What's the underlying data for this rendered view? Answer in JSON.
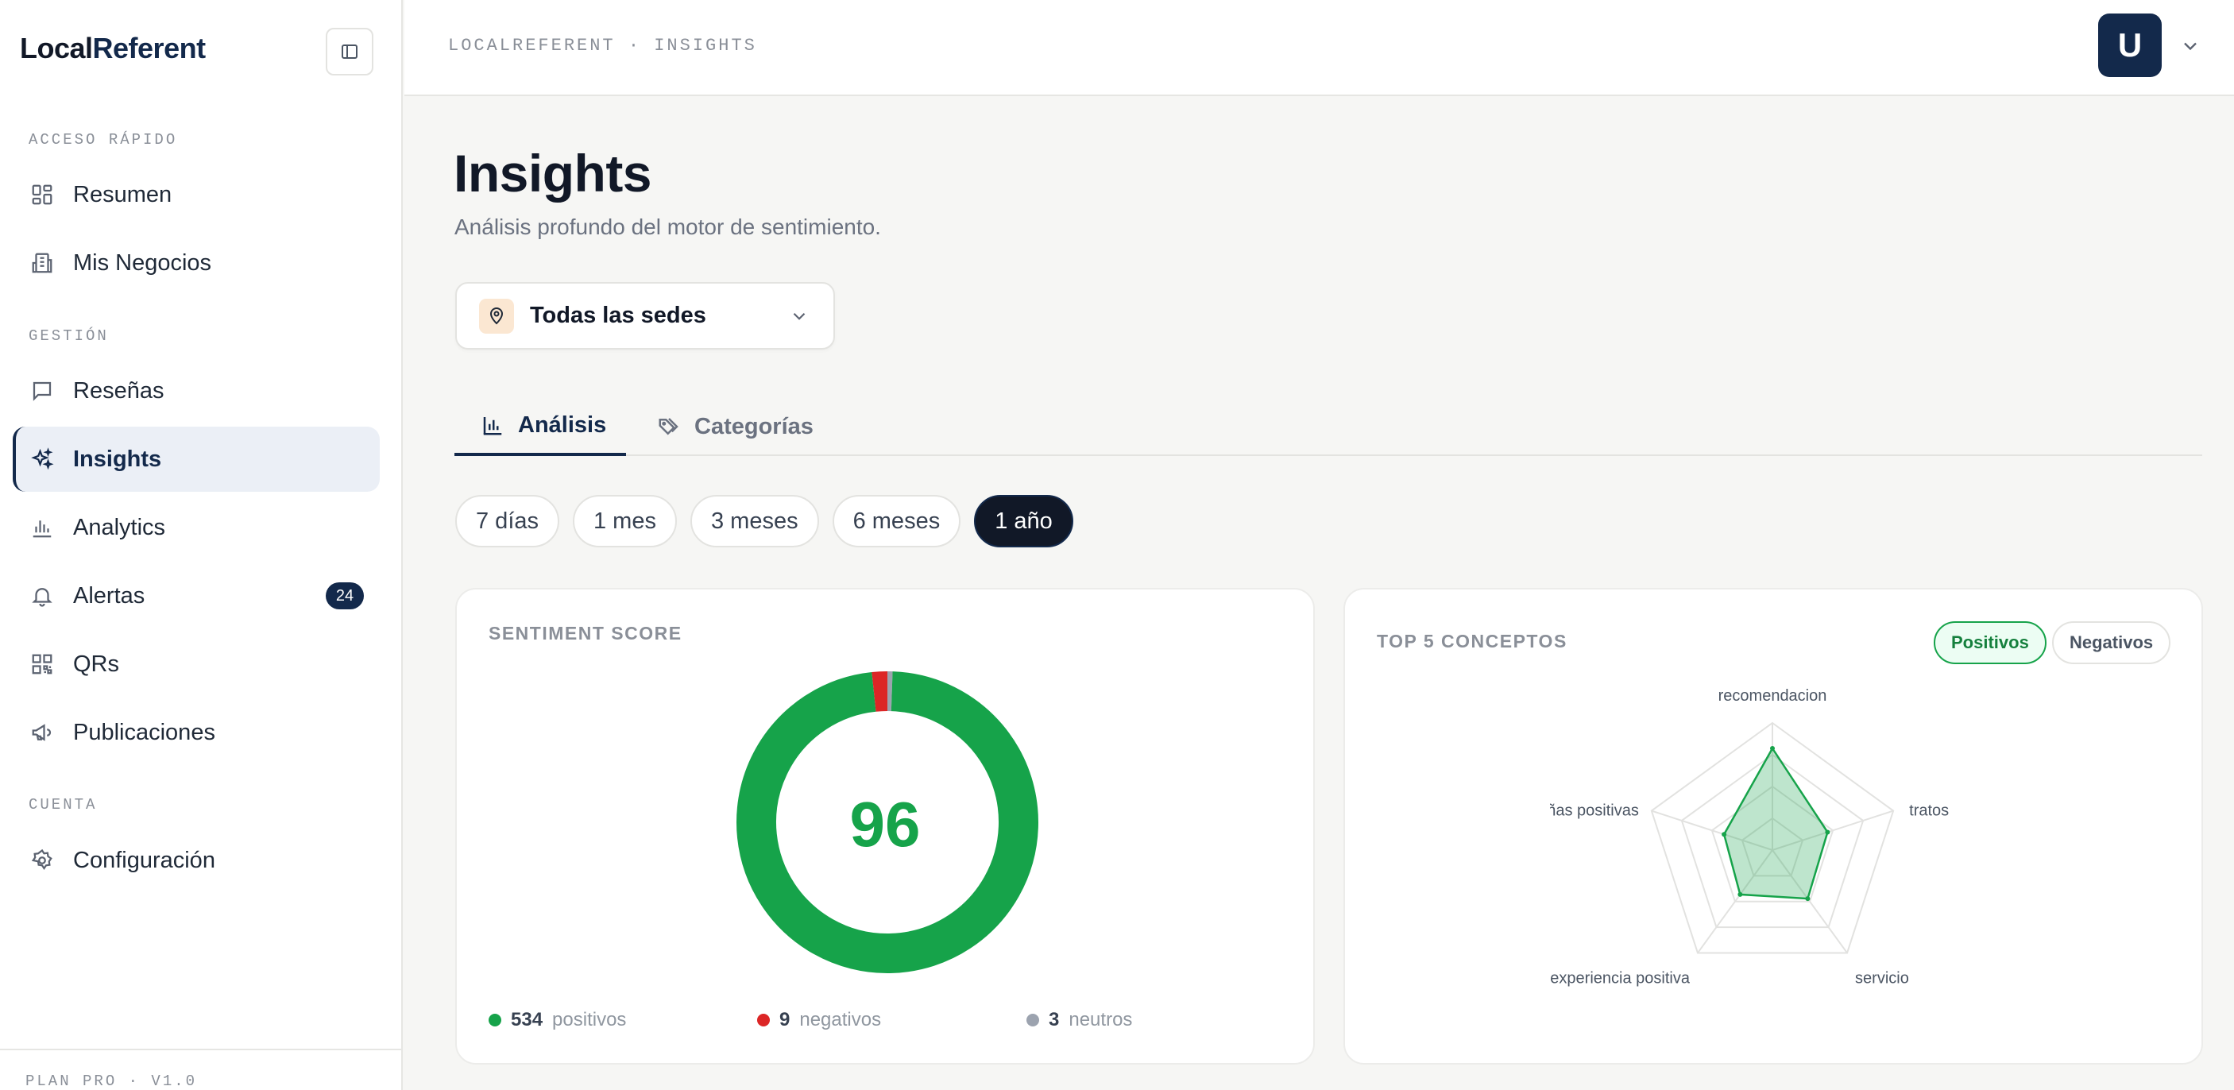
{
  "app": {
    "logo_main": "Local",
    "logo_accent": "Referent"
  },
  "sidebar": {
    "sections": [
      {
        "label": "ACCESO RÁPIDO"
      },
      {
        "label": "GESTIÓN"
      },
      {
        "label": "CUENTA"
      }
    ],
    "items": [
      {
        "label": "Resumen",
        "icon": "grid-icon"
      },
      {
        "label": "Mis Negocios",
        "icon": "building-icon"
      },
      {
        "label": "Reseñas",
        "icon": "message-icon"
      },
      {
        "label": "Insights",
        "icon": "sparkles-icon",
        "active": true
      },
      {
        "label": "Analytics",
        "icon": "bar-chart-icon"
      },
      {
        "label": "Alertas",
        "icon": "bell-icon",
        "badge": "24"
      },
      {
        "label": "QRs",
        "icon": "qr-icon"
      },
      {
        "label": "Publicaciones",
        "icon": "megaphone-icon"
      },
      {
        "label": "Configuración",
        "icon": "gear-icon"
      }
    ],
    "footer": "PLAN PRO · V1.0"
  },
  "topbar": {
    "breadcrumb": "LOCALREFERENT · INSIGHTS",
    "avatar_initial": "U"
  },
  "page": {
    "title": "Insights",
    "subtitle": "Análisis profundo del motor de sentimiento."
  },
  "location_select": {
    "value": "Todas las sedes"
  },
  "tabs": [
    {
      "label": "Análisis",
      "icon": "bar-chart-icon",
      "active": true
    },
    {
      "label": "Categorías",
      "icon": "tags-icon",
      "active": false
    }
  ],
  "periods": [
    {
      "label": "7 días",
      "active": false
    },
    {
      "label": "1 mes",
      "active": false
    },
    {
      "label": "3 meses",
      "active": false
    },
    {
      "label": "6 meses",
      "active": false
    },
    {
      "label": "1 año",
      "active": true
    }
  ],
  "sentiment": {
    "title": "SENTIMENT SCORE",
    "score": "96",
    "positives": {
      "count": "534",
      "label": "positivos"
    },
    "negatives": {
      "count": "9",
      "label": "negativos"
    },
    "neutrals": {
      "count": "3",
      "label": "neutros"
    }
  },
  "concepts": {
    "title": "TOP 5 CONCEPTOS",
    "toggle_positive": "Positivos",
    "toggle_negative": "Negativos",
    "axis_labels": [
      "recomendacion",
      "tratos",
      "servicio",
      "experiencia positiva",
      "reseñas positivas"
    ]
  },
  "colors": {
    "positive": "#16a34a",
    "negative": "#dc2626",
    "neutral": "#9ca3af",
    "brand": "#13294b"
  },
  "chart_data": [
    {
      "type": "pie",
      "title": "SENTIMENT SCORE",
      "categories": [
        "positivos",
        "negativos",
        "neutros"
      ],
      "values": [
        534,
        9,
        3
      ]
    },
    {
      "type": "radar",
      "title": "TOP 5 CONCEPTOS",
      "categories": [
        "recomendacion",
        "tratos",
        "servicio",
        "experiencia positiva",
        "reseñas positivas"
      ],
      "values": [
        1.0,
        0.57,
        0.59,
        0.54,
        0.5
      ],
      "range": [
        0,
        1.25
      ]
    }
  ]
}
